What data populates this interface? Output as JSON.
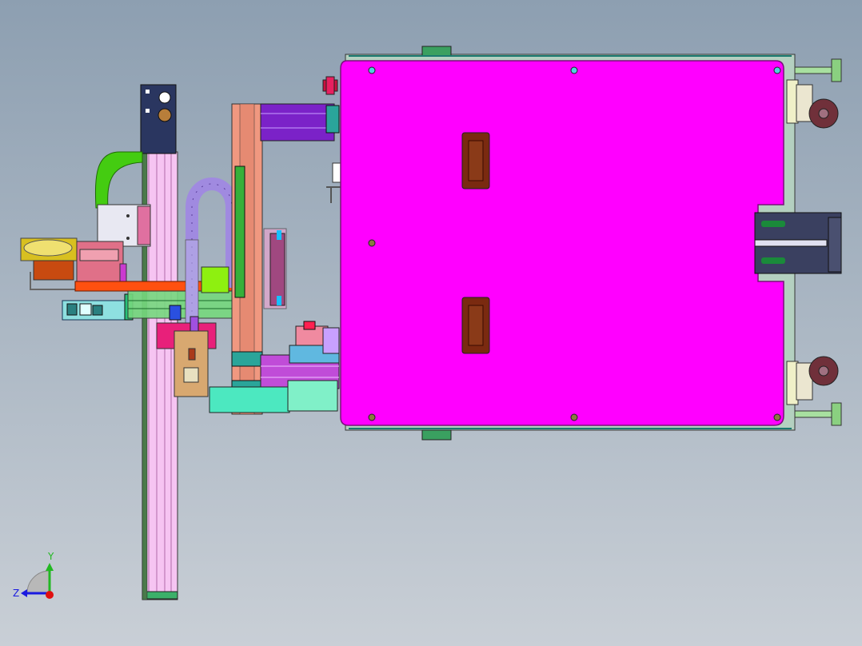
{
  "viewport": {
    "background_top": "#8d9fb1",
    "background_bottom": "#c9cfd6"
  },
  "triad": {
    "y_label": "Y",
    "z_label": "Z",
    "y_color": "#22b822",
    "z_color": "#1a1ae0",
    "x_color": "#e01010"
  },
  "colors": {
    "table_panel": "#ff00ff",
    "table_edge": "#7a107a",
    "handle": "#7a2a10",
    "frame_pink": "#f0a8a8",
    "frame_vertical": "#f6c4f2",
    "teal": "#2aa59a",
    "purple": "#7b22c8",
    "green_hose": "#44cc11",
    "navy_box": "#2a3660",
    "gold": "#d8c020",
    "orange": "#ff5010",
    "caster": "#70303a",
    "foot": "#a8e0a0"
  }
}
